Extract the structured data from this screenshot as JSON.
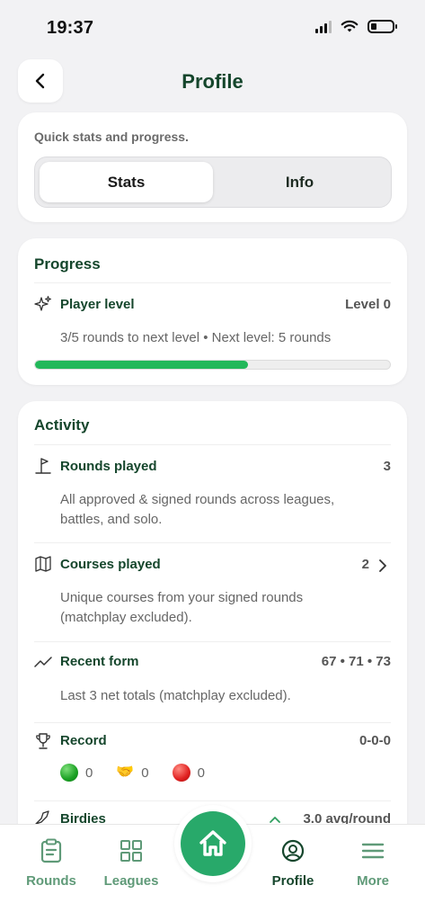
{
  "status_bar": {
    "time": "19:37"
  },
  "header": {
    "title": "Profile"
  },
  "overview": {
    "subtitle": "Quick stats and progress.",
    "tabs": [
      {
        "label": "Stats",
        "selected": true
      },
      {
        "label": "Info",
        "selected": false
      }
    ]
  },
  "progress": {
    "title": "Progress",
    "player_level": {
      "label": "Player level",
      "value": "Level 0",
      "description": "3/5 rounds to next level • Next level: 5 rounds",
      "progress_fraction": 0.6
    }
  },
  "activity": {
    "title": "Activity",
    "rounds_played": {
      "label": "Rounds played",
      "value": "3",
      "description": "All approved & signed rounds across leagues, battles, and solo."
    },
    "courses_played": {
      "label": "Courses played",
      "value": "2",
      "description": "Unique courses from your signed rounds (matchplay excluded)."
    },
    "recent_form": {
      "label": "Recent form",
      "value": "67 • 71 • 73",
      "description": "Last 3 net totals (matchplay excluded)."
    },
    "record": {
      "label": "Record",
      "value": "0-0-0",
      "wins": "0",
      "halves": "0",
      "losses": "0"
    },
    "birdies": {
      "label": "Birdies",
      "value": "3.0 avg/round"
    }
  },
  "nav": {
    "rounds": "Rounds",
    "leagues": "Leagues",
    "profile": "Profile",
    "more": "More"
  },
  "colors": {
    "accent": "#22b85a",
    "primary_text": "#15462c",
    "home_button": "#28a96a",
    "nav_inactive": "#5f9a78"
  }
}
